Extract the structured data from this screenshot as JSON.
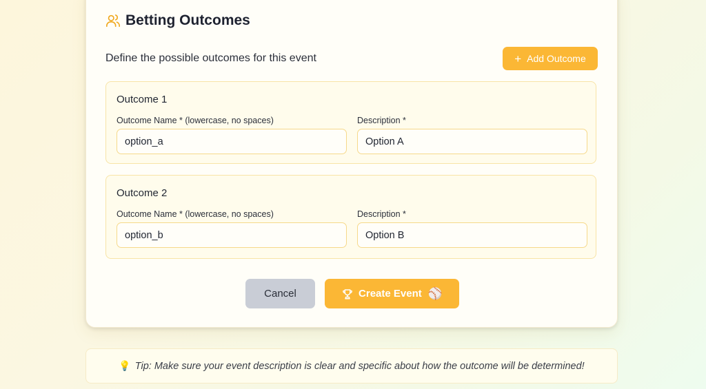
{
  "section": {
    "title": "Betting Outcomes",
    "icon": "users-icon",
    "subtitle": "Define the possible outcomes for this event",
    "add_button_label": "Add Outcome"
  },
  "outcomes": [
    {
      "title": "Outcome 1",
      "name_label": "Outcome Name * (lowercase, no spaces)",
      "name_value": "option_a",
      "desc_label": "Description *",
      "desc_value": "Option A"
    },
    {
      "title": "Outcome 2",
      "name_label": "Outcome Name * (lowercase, no spaces)",
      "name_value": "option_b",
      "desc_label": "Description *",
      "desc_value": "Option B"
    }
  ],
  "actions": {
    "cancel_label": "Cancel",
    "create_label": "Create Event",
    "create_emoji": "⚾"
  },
  "tip": {
    "emoji": "💡",
    "text": "Tip: Make sure your event description is clear and specific about how the outcome will be determined!"
  },
  "colors": {
    "accent": "#fbb735",
    "cancel": "#c9cdd6",
    "outcome_border": "#f8e4a6"
  }
}
